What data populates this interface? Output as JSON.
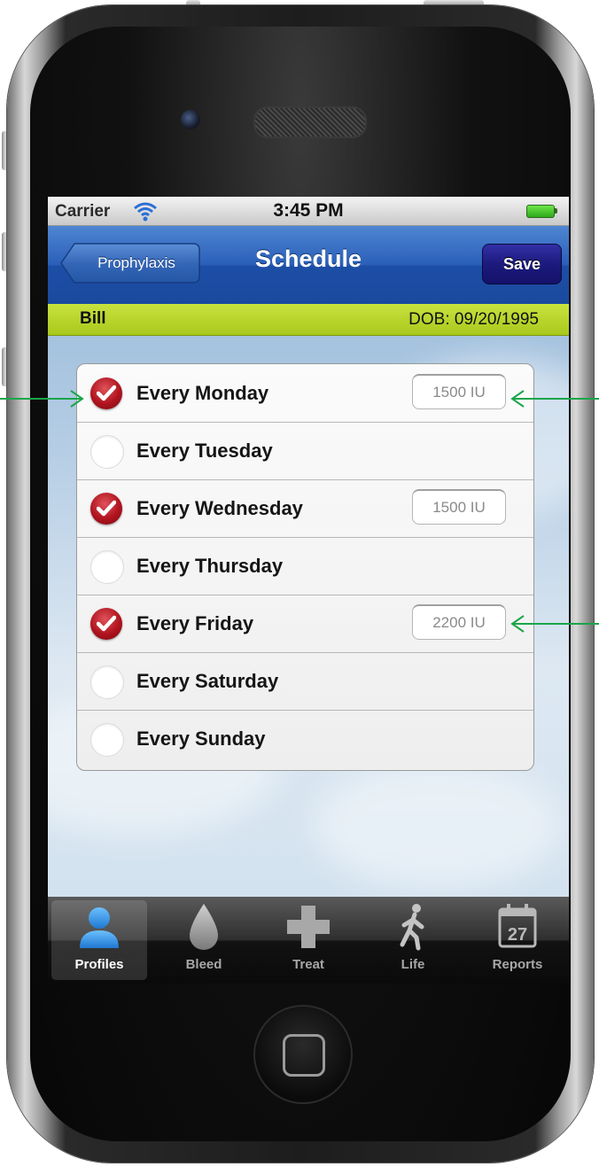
{
  "status_bar": {
    "carrier": "Carrier",
    "time": "3:45 PM"
  },
  "nav": {
    "back_label": "Prophylaxis",
    "title": "Schedule",
    "save_label": "Save"
  },
  "profile": {
    "name": "Bill",
    "dob": "DOB: 09/20/1995"
  },
  "schedule": [
    {
      "label": "Every Monday",
      "checked": true,
      "dose": "1500 IU"
    },
    {
      "label": "Every Tuesday",
      "checked": false,
      "dose": ""
    },
    {
      "label": "Every Wednesday",
      "checked": true,
      "dose": "1500 IU"
    },
    {
      "label": "Every Thursday",
      "checked": false,
      "dose": ""
    },
    {
      "label": "Every Friday",
      "checked": true,
      "dose": "2200 IU"
    },
    {
      "label": "Every Saturday",
      "checked": false,
      "dose": ""
    },
    {
      "label": "Every Sunday",
      "checked": false,
      "dose": ""
    }
  ],
  "tabs": [
    {
      "label": "Profiles",
      "icon": "person-icon",
      "active": true
    },
    {
      "label": "Bleed",
      "icon": "drop-icon",
      "active": false
    },
    {
      "label": "Treat",
      "icon": "cross-icon",
      "active": false
    },
    {
      "label": "Life",
      "icon": "walking-person-icon",
      "active": false
    },
    {
      "label": "Reports",
      "icon": "calendar-icon",
      "calendar_day": "27",
      "active": false
    }
  ],
  "colors": {
    "nav_blue": "#2a5fb8",
    "save_button": "#1c1a7c",
    "profile_bar": "#b8d42a",
    "check_red": "#b0141f",
    "tab_active_icon": "#3a9ae0",
    "annotation_arrow": "#1aa54a"
  }
}
